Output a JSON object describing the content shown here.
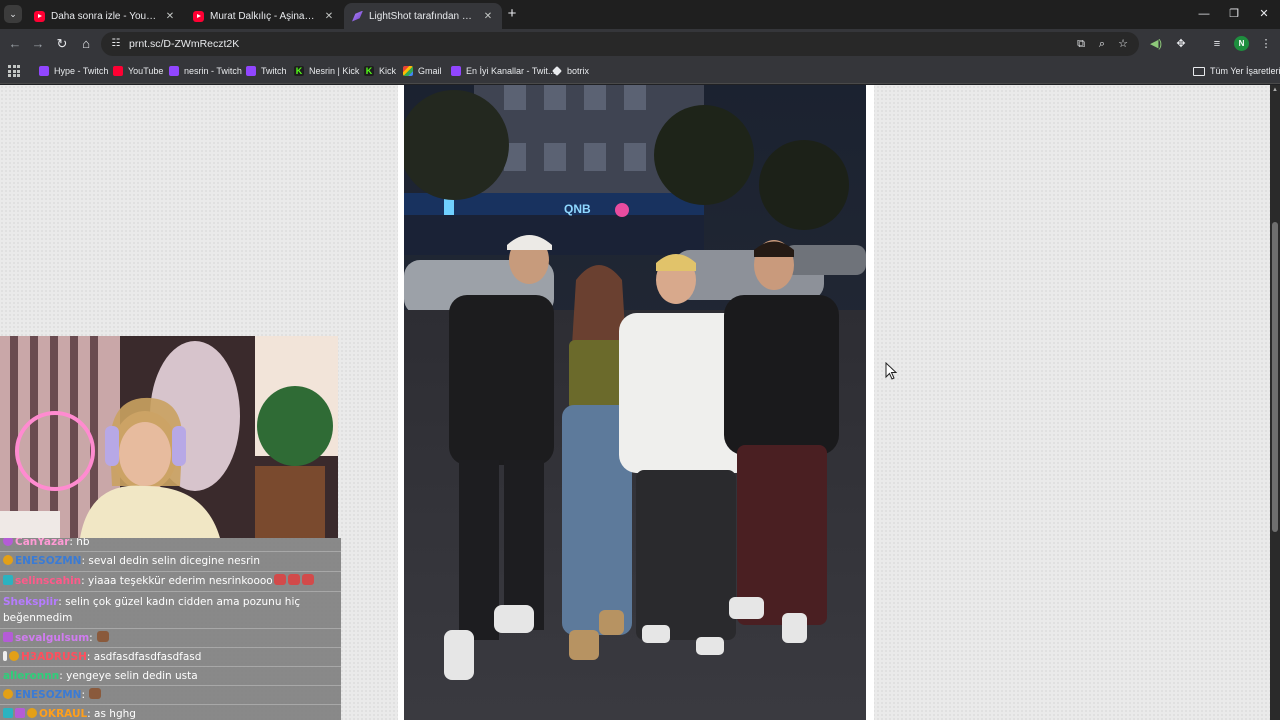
{
  "browser": {
    "tabs": [
      {
        "title": "Daha sonra izle - YouTube",
        "icon": "youtube-icon",
        "active": false
      },
      {
        "title": "Murat Dalkılıç - Aşinayız ft. Oğu",
        "icon": "youtube-icon",
        "active": false
      },
      {
        "title": "LightShot tarafından Ekran Görü",
        "icon": "lightshot-icon",
        "active": true
      }
    ],
    "url": "prnt.sc/D-ZWmReczt2K",
    "bookmarks": [
      {
        "label": "Hype - Twitch",
        "icon": "twitch-icon"
      },
      {
        "label": "YouTube",
        "icon": "youtube-icon"
      },
      {
        "label": "nesrin - Twitch",
        "icon": "twitch-icon"
      },
      {
        "label": "Twitch",
        "icon": "twitch-icon"
      },
      {
        "label": "Nesrin | Kick",
        "icon": "kick-icon"
      },
      {
        "label": "Kick",
        "icon": "kick-icon"
      },
      {
        "label": "Gmail",
        "icon": "gmail-icon"
      },
      {
        "label": "En İyi Kanallar - Twit...",
        "icon": "twitch-icon"
      },
      {
        "label": "botrix",
        "icon": "botrix-icon"
      }
    ],
    "all_bookmarks_label": "Tüm Yer İşaretleri",
    "profile_initial": "N"
  },
  "photo_sign": "QNB",
  "chat": {
    "messages": [
      {
        "user": "CanYazar",
        "text": ": hb",
        "name_color": "#ff9ad5"
      },
      {
        "user": "ENESOZMN",
        "text": ": seval dedin selin dicegine nesrin",
        "name_color": "#3b7bd4"
      },
      {
        "user": "selinscahin",
        "text": ": yiaaa teşekkür ederim nesrinkoooo",
        "name_color": "#ff5a8a"
      },
      {
        "user": "Shekspiir",
        "text": ": selin çok güzel kadın cidden ama pozunu hiç beğenmedim",
        "name_color": "#b67cff"
      },
      {
        "user": "sevalgulsum",
        "text": ":",
        "name_color": "#d07cf0"
      },
      {
        "user": "H3ADRUSH",
        "text": ": asdfasdfasdfasdfasd",
        "name_color": "#ff4f5e"
      },
      {
        "user": "alleronnn",
        "text": ": yengeye selin dedin usta",
        "name_color": "#2ecf7a"
      },
      {
        "user": "ENESOZMN",
        "text": ":",
        "name_color": "#3b7bd4"
      },
      {
        "user": "OKRAUL",
        "text": ": as hghg",
        "name_color": "#ff9f1a"
      }
    ]
  }
}
